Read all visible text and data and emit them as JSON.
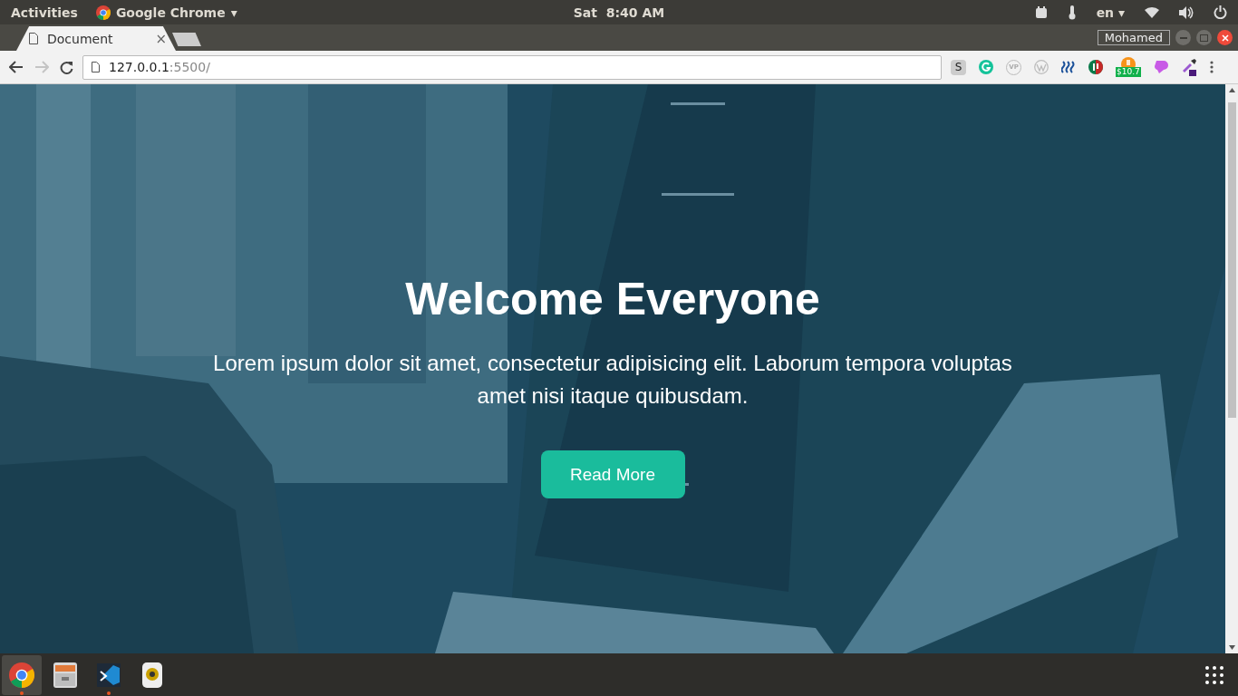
{
  "top_panel": {
    "activities": "Activities",
    "app_menu": {
      "label": "Google Chrome",
      "arrow": "▾"
    },
    "clock": "Sat  8:40 AM",
    "keyboard_layout": {
      "label": "en",
      "arrow": "▾"
    },
    "tray": [
      {
        "kind": "calendar"
      },
      {
        "kind": "thermometer"
      },
      {
        "kind": "keyboard"
      },
      {
        "kind": "wifi"
      },
      {
        "kind": "volume"
      },
      {
        "kind": "power"
      }
    ]
  },
  "tabs": [
    {
      "label": "Document",
      "selected": true,
      "close": "×"
    }
  ],
  "profile": "Mohamed",
  "toolbar": {
    "nav": [
      {
        "kind": "back",
        "disabled": false
      },
      {
        "kind": "forward",
        "disabled": true
      },
      {
        "kind": "reload",
        "disabled": false
      }
    ],
    "address": {
      "host": "127.0.0.1",
      "rest": ":5500/"
    },
    "extensions": [
      {
        "kind": "letter",
        "glyph": "S"
      },
      {
        "kind": "grammar"
      },
      {
        "kind": "outline",
        "glyph": "VP"
      },
      {
        "kind": "wordpress"
      },
      {
        "kind": "steem"
      },
      {
        "kind": "bars"
      },
      {
        "kind": "bitcoin",
        "badge": "$10.7"
      },
      {
        "kind": "blob"
      },
      {
        "kind": "dropper"
      },
      {
        "kind": "menu"
      }
    ]
  },
  "hero": {
    "title": "Welcome Everyone",
    "text": "Lorem ipsum dolor sit amet, consectetur adipisicing elit. Laborum tempora voluptas amet nisi itaque quibusdam.",
    "button": "Read More"
  },
  "dock": {
    "apps": [
      {
        "kind": "chrome",
        "selected": true,
        "running": true
      },
      {
        "kind": "files",
        "selected": false,
        "running": false
      },
      {
        "kind": "code",
        "selected": false,
        "running": true
      },
      {
        "kind": "speaker",
        "selected": false,
        "running": false
      }
    ]
  }
}
